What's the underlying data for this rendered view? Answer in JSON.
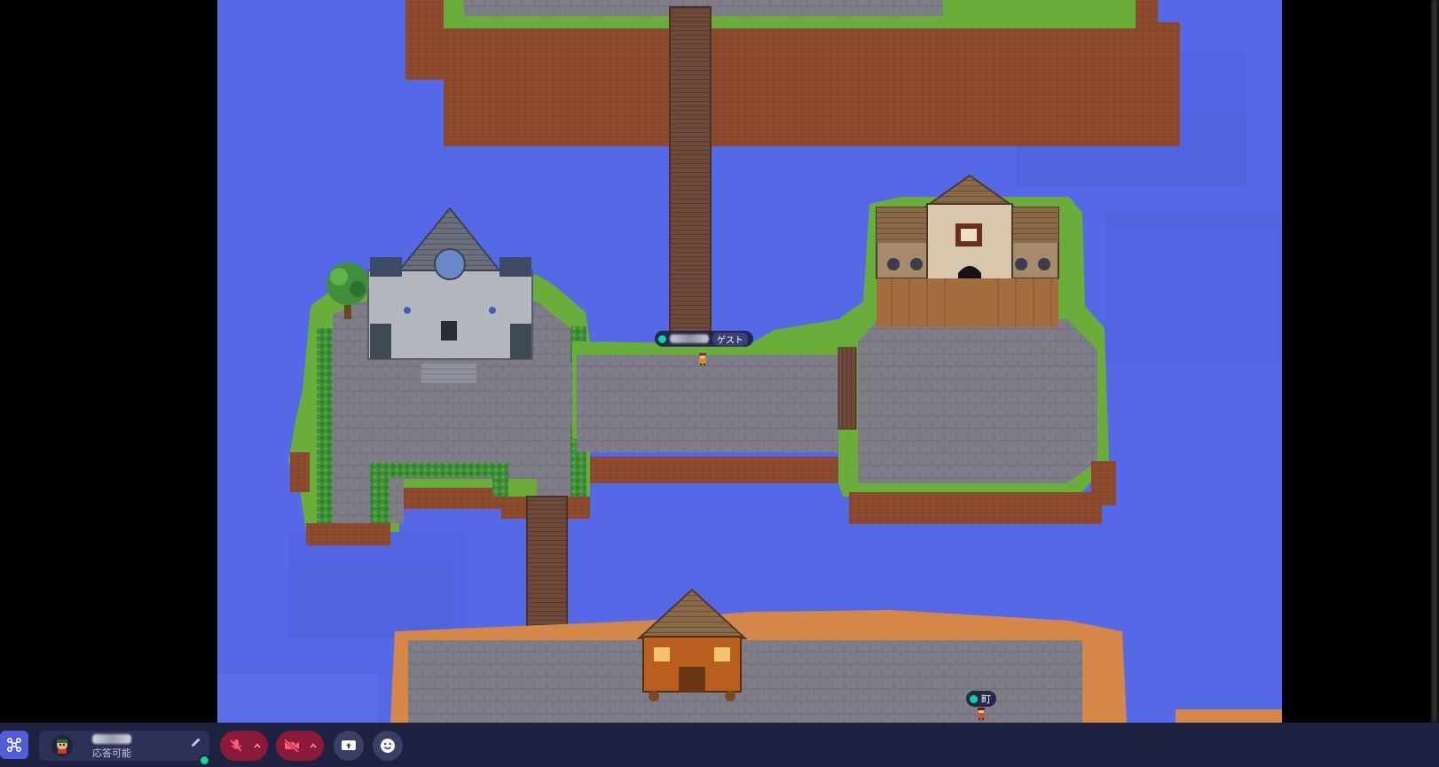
{
  "players": [
    {
      "name_hidden": true,
      "role_badge": "ゲスト"
    },
    {
      "name": "町"
    }
  ],
  "profile": {
    "name_hidden": true,
    "status_text": "応答可能",
    "edit_icon": "pencil-icon",
    "status_color": "#06d6a0"
  },
  "controls": {
    "menu": "network-icon",
    "microphone": {
      "state": "muted",
      "icon": "mic-off-icon"
    },
    "camera": {
      "state": "off",
      "icon": "camera-off-icon"
    },
    "screen_share": "share-screen-icon",
    "emote": "smiley-icon"
  },
  "colors": {
    "water": "#5569e6",
    "grass": "#6aad3a",
    "cliff": "#8b4a2e",
    "cobble": "#7e7d88",
    "sand": "#d5874a",
    "bar": "#1f2140",
    "muted_red": "#8a1a3a"
  }
}
